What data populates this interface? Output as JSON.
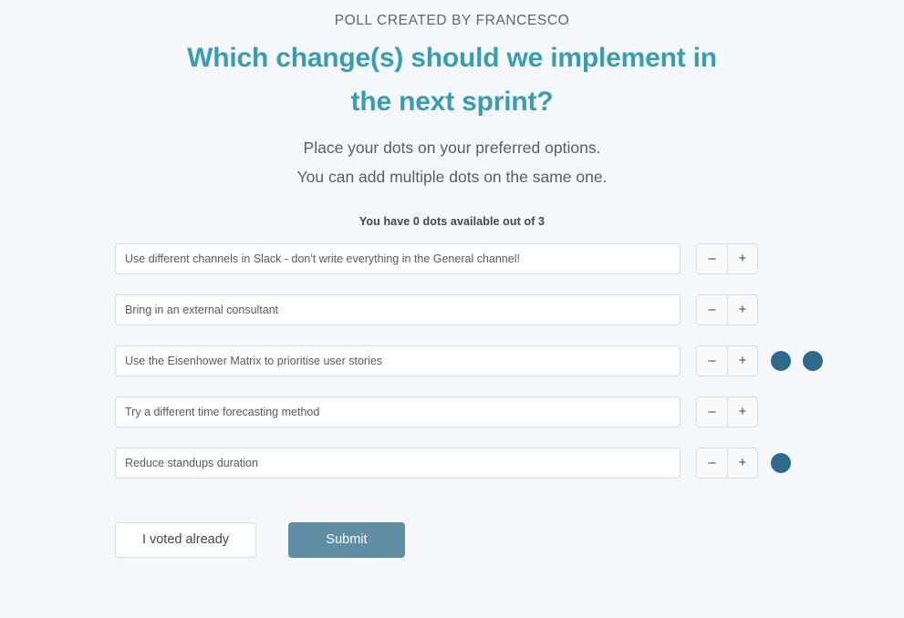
{
  "theme": {
    "background": "#f4f8fb",
    "title_color": "#3a9cb0",
    "dot_color": "#2e6a8b",
    "submit_color": "#5e8da4",
    "text_color": "#545c64",
    "border_color": "#d7dce1"
  },
  "header": {
    "author_line": "POLL CREATED BY FRANCESCO",
    "title": "Which change(s) should we implement in the next sprint?",
    "instruction_line_1": "Place your dots on your preferred options.",
    "instruction_line_2": "You can add multiple dots on the same one."
  },
  "counter": {
    "text": "You have 0 dots available out of 3",
    "dots_available": 0,
    "dots_total": 3
  },
  "stepper": {
    "minus_label": "–",
    "plus_label": "+"
  },
  "options": [
    {
      "value": "Use different channels in Slack - don't write everything in the General channel!",
      "placeholder": "Type an option",
      "dots": 0
    },
    {
      "value": "Bring in an external consultant",
      "placeholder": "Type an option",
      "dots": 0
    },
    {
      "value": "Use the Eisenhower Matrix to prioritise user stories",
      "placeholder": "Type an option",
      "dots": 2
    },
    {
      "value": "Try a different time forecasting method",
      "placeholder": "Type an option",
      "dots": 0
    },
    {
      "value": "Reduce standups duration",
      "placeholder": "Type an option",
      "dots": 1
    }
  ],
  "actions": {
    "voted_already_label": "I voted already",
    "submit_label": "Submit"
  }
}
